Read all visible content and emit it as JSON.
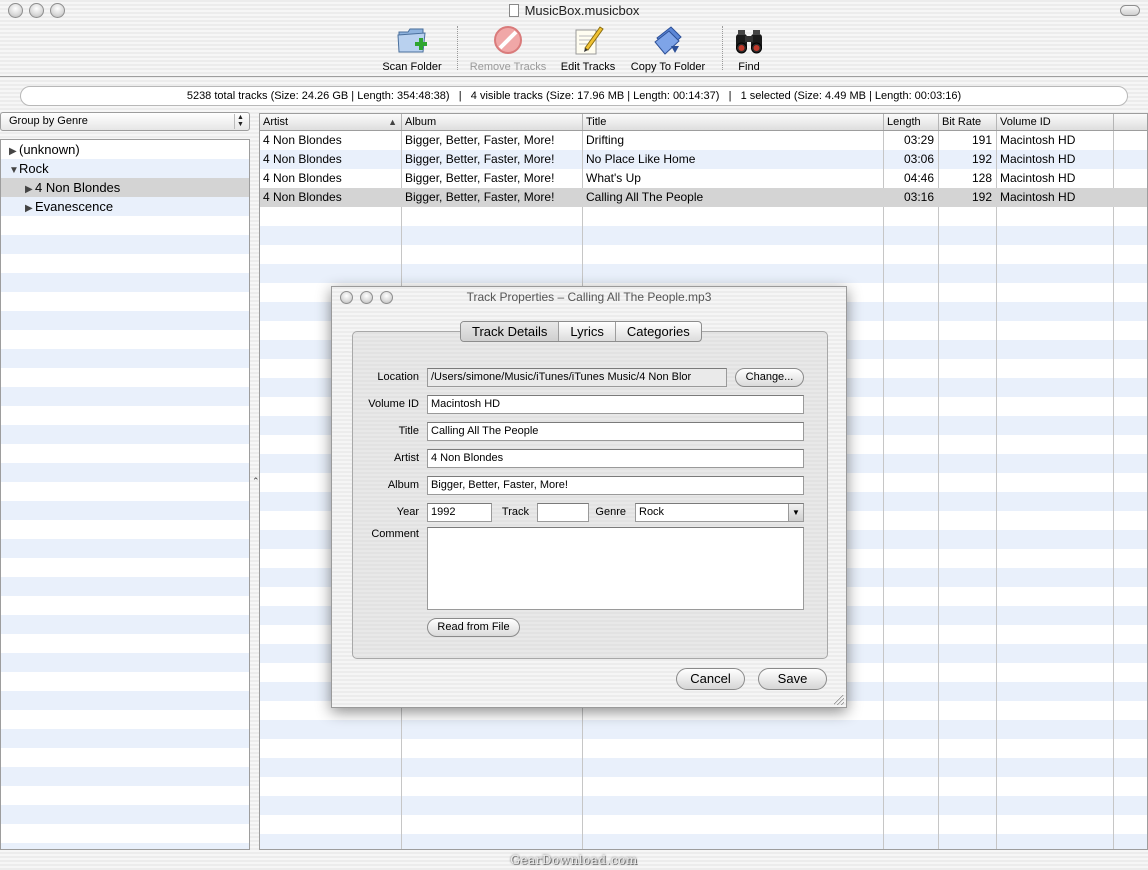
{
  "window": {
    "title": "MusicBox.musicbox"
  },
  "toolbar": {
    "scan_folder": "Scan Folder",
    "remove_tracks": "Remove Tracks",
    "edit_tracks": "Edit Tracks",
    "copy_to_folder": "Copy To Folder",
    "find": "Find"
  },
  "status": {
    "text": "5238 total tracks (Size: 24.26 GB | Length: 354:48:38)   |   4 visible tracks (Size: 17.96 MB | Length: 00:14:37)   |   1 selected (Size: 4.49 MB | Length: 00:03:16)"
  },
  "group_by": {
    "selected": "Group by Genre"
  },
  "tree": {
    "items": [
      {
        "label": "(unknown)"
      },
      {
        "label": "Rock"
      },
      {
        "label": "4 Non Blondes"
      },
      {
        "label": "Evanescence"
      }
    ]
  },
  "table": {
    "columns": [
      "Artist",
      "Album",
      "Title",
      "Length",
      "Bit Rate",
      "Volume ID"
    ],
    "rows": [
      {
        "artist": "4 Non Blondes",
        "album": "Bigger, Better, Faster, More!",
        "title": "Drifting",
        "length": "03:29",
        "bitrate": "191",
        "volume": "Macintosh HD"
      },
      {
        "artist": "4 Non Blondes",
        "album": "Bigger, Better, Faster, More!",
        "title": "No Place Like Home",
        "length": "03:06",
        "bitrate": "192",
        "volume": "Macintosh HD"
      },
      {
        "artist": "4 Non Blondes",
        "album": "Bigger, Better, Faster, More!",
        "title": "What's Up",
        "length": "04:46",
        "bitrate": "128",
        "volume": "Macintosh HD"
      },
      {
        "artist": "4 Non Blondes",
        "album": "Bigger, Better, Faster, More!",
        "title": "Calling All The People",
        "length": "03:16",
        "bitrate": "192",
        "volume": "Macintosh HD"
      }
    ]
  },
  "dialog": {
    "title": "Track Properties – Calling All The People.mp3",
    "tabs": [
      "Track Details",
      "Lyrics",
      "Categories"
    ],
    "labels": {
      "location": "Location",
      "volume_id": "Volume ID",
      "title": "Title",
      "artist": "Artist",
      "album": "Album",
      "year": "Year",
      "track": "Track",
      "genre": "Genre",
      "comment": "Comment"
    },
    "values": {
      "location": "/Users/simone/Music/iTunes/iTunes Music/4 Non Blor",
      "volume_id": "Macintosh HD",
      "title": "Calling All The People",
      "artist": "4 Non Blondes",
      "album": "Bigger, Better, Faster, More!",
      "year": "1992",
      "track": "",
      "genre": "Rock",
      "comment": ""
    },
    "change_button": "Change...",
    "read_from_file_button": "Read from File",
    "cancel_button": "Cancel",
    "save_button": "Save"
  },
  "watermark": "GearDownload.com"
}
